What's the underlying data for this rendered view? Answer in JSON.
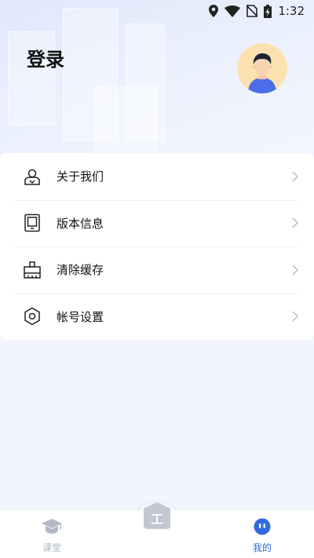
{
  "status_bar": {
    "time": "1:32",
    "icons": [
      "location-icon",
      "wifi-icon",
      "no-sim-icon",
      "battery-charging-icon"
    ]
  },
  "page": {
    "title": "登录",
    "avatar_icon": "user-avatar-icon"
  },
  "menu": {
    "items": [
      {
        "label": "关于我们",
        "icon": "about-us-icon"
      },
      {
        "label": "版本信息",
        "icon": "tablet-icon"
      },
      {
        "label": "清除缓存",
        "icon": "broom-icon"
      },
      {
        "label": "帐号设置",
        "icon": "hexagon-settings-icon"
      }
    ]
  },
  "tabbar": {
    "tabs": [
      {
        "label": "课堂",
        "icon": "graduation-cap-icon",
        "active": false
      },
      {
        "label": "",
        "icon": "work-icon",
        "active": false,
        "glyph": "工"
      },
      {
        "label": "我的",
        "icon": "profile-face-icon",
        "active": true
      }
    ],
    "active_color": "#2f6bdc",
    "inactive_color": "#b3b8c4"
  }
}
